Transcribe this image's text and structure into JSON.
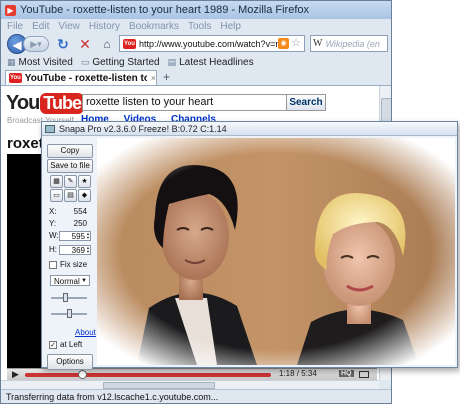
{
  "browser": {
    "title": "YouTube - roxette-listen to your heart 1989 - Mozilla Firefox",
    "menu": [
      "File",
      "Edit",
      "View",
      "History",
      "Bookmarks",
      "Tools",
      "Help"
    ],
    "url": "http://www.youtube.com/watch?v=npC",
    "search_placeholder": "Wikipedia (en",
    "bookmarks": [
      "Most Visited",
      "Getting Started",
      "Latest Headlines"
    ],
    "tab_label": "YouTube - roxette-listen to your hea...",
    "tab_close": "×",
    "new_tab": "+",
    "status": "Transferring data from v12.lscache1.c.youtube.com..."
  },
  "youtube": {
    "logo_you": "You",
    "logo_tube": "Tube",
    "tagline": "Broadcast Yourself",
    "search_value": "roxette listen to your heart",
    "search_button": "Search",
    "nav": [
      "Home",
      "Videos",
      "Channels"
    ],
    "video_title": "roxette",
    "player": {
      "time": "1:18 / 5:34",
      "hq": "HQ",
      "progress_fraction": 0.23
    }
  },
  "snapa": {
    "title": "Snapa Pro v2.3.6.0 Freeze! B:0.72  C:1.14",
    "copy_label": "Copy",
    "save_label": "Save to file",
    "x_label": "X:",
    "x_value": "554",
    "y_label": "Y:",
    "y_value": "250",
    "w_label": "W:",
    "w_value": "595",
    "h_label": "H:",
    "h_value": "369",
    "fix_size_label": "Fix size",
    "zoom_mode": "Normal",
    "about_label": "About",
    "at_left_label": "at Left",
    "at_left_checked": "✓",
    "options_label": "Options"
  }
}
